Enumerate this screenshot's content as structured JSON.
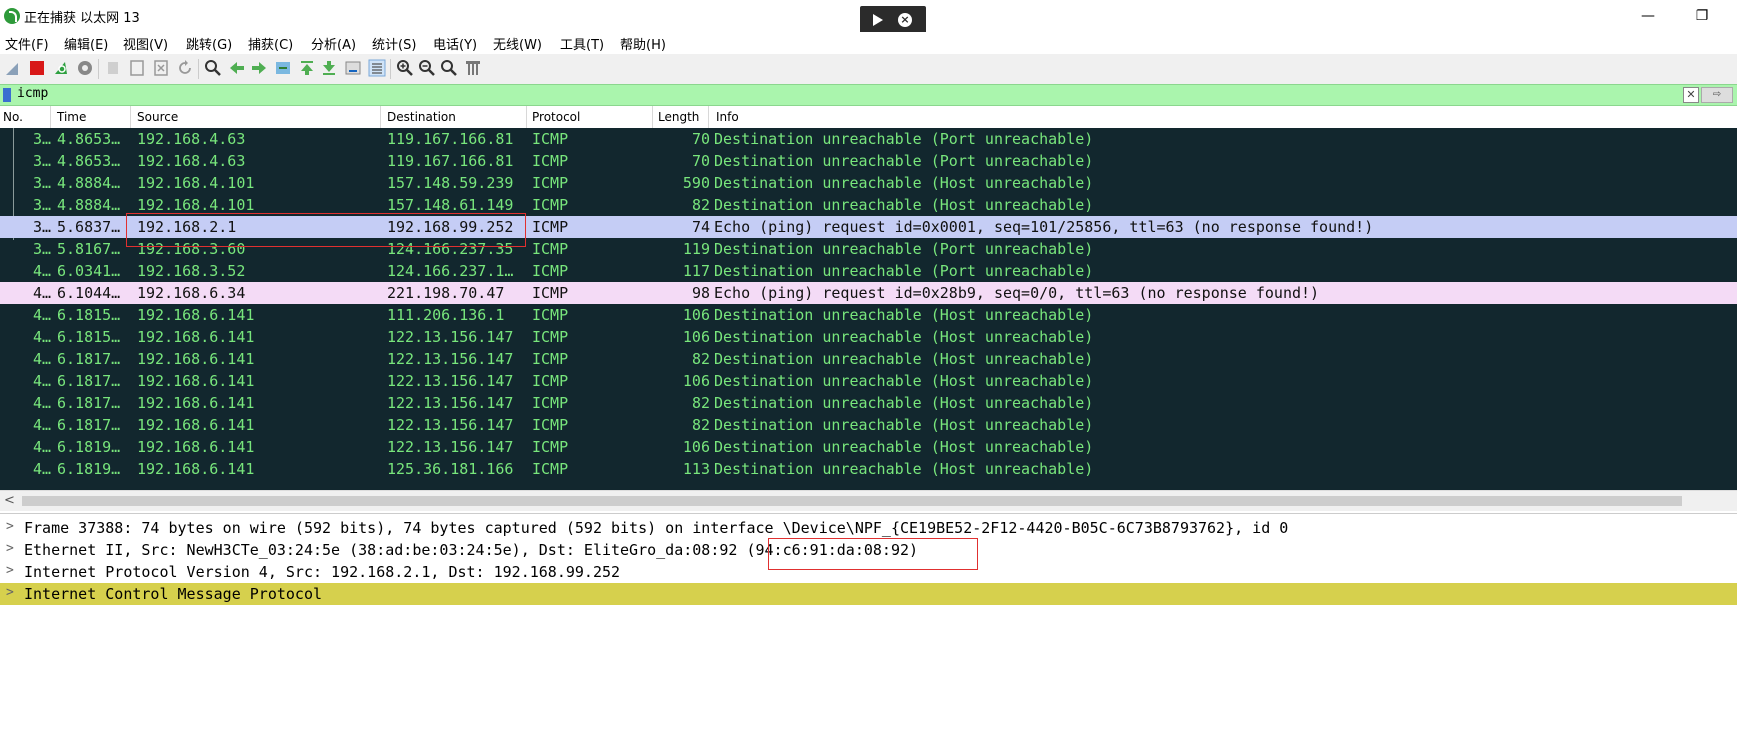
{
  "window": {
    "title": "正在捕获 以太网 13",
    "min": "—",
    "max": "❐"
  },
  "menu": [
    "文件(F)",
    "编辑(E)",
    "视图(V)",
    "跳转(G)",
    "捕获(C)",
    "分析(A)",
    "统计(S)",
    "电话(Y)",
    "无线(W)",
    "工具(T)",
    "帮助(H)"
  ],
  "filter": {
    "value": "icmp",
    "clear": "✕",
    "apply": "⇨"
  },
  "columns": {
    "no": "No.",
    "time": "Time",
    "source": "Source",
    "destination": "Destination",
    "protocol": "Protocol",
    "length": "Length",
    "info": "Info"
  },
  "packets": [
    {
      "no": "3…",
      "time": "4.8653…",
      "src": "192.168.4.63",
      "dst": "119.167.166.81",
      "proto": "ICMP",
      "len": "70",
      "info": "Destination unreachable (Port unreachable)"
    },
    {
      "no": "3…",
      "time": "4.8653…",
      "src": "192.168.4.63",
      "dst": "119.167.166.81",
      "proto": "ICMP",
      "len": "70",
      "info": "Destination unreachable (Port unreachable)"
    },
    {
      "no": "3…",
      "time": "4.8884…",
      "src": "192.168.4.101",
      "dst": "157.148.59.239",
      "proto": "ICMP",
      "len": "590",
      "info": "Destination unreachable (Host unreachable)"
    },
    {
      "no": "3…",
      "time": "4.8884…",
      "src": "192.168.4.101",
      "dst": "157.148.61.149",
      "proto": "ICMP",
      "len": "82",
      "info": "Destination unreachable (Host unreachable)"
    },
    {
      "no": "3…",
      "time": "5.6837…",
      "src": "192.168.2.1",
      "dst": "192.168.99.252",
      "proto": "ICMP",
      "len": "74",
      "info": "Echo (ping) request  id=0x0001, seq=101/25856, ttl=63 (no response found!)"
    },
    {
      "no": "3…",
      "time": "5.8167…",
      "src": "192.168.3.60",
      "dst": "124.166.237.35",
      "proto": "ICMP",
      "len": "119",
      "info": "Destination unreachable (Port unreachable)"
    },
    {
      "no": "4…",
      "time": "6.0341…",
      "src": "192.168.3.52",
      "dst": "124.166.237.1…",
      "proto": "ICMP",
      "len": "117",
      "info": "Destination unreachable (Port unreachable)"
    },
    {
      "no": "4…",
      "time": "6.1044…",
      "src": "192.168.6.34",
      "dst": "221.198.70.47",
      "proto": "ICMP",
      "len": "98",
      "info": "Echo (ping) request  id=0x28b9, seq=0/0, ttl=63 (no response found!)"
    },
    {
      "no": "4…",
      "time": "6.1815…",
      "src": "192.168.6.141",
      "dst": "111.206.136.1",
      "proto": "ICMP",
      "len": "106",
      "info": "Destination unreachable (Host unreachable)"
    },
    {
      "no": "4…",
      "time": "6.1815…",
      "src": "192.168.6.141",
      "dst": "122.13.156.147",
      "proto": "ICMP",
      "len": "106",
      "info": "Destination unreachable (Host unreachable)"
    },
    {
      "no": "4…",
      "time": "6.1817…",
      "src": "192.168.6.141",
      "dst": "122.13.156.147",
      "proto": "ICMP",
      "len": "82",
      "info": "Destination unreachable (Host unreachable)"
    },
    {
      "no": "4…",
      "time": "6.1817…",
      "src": "192.168.6.141",
      "dst": "122.13.156.147",
      "proto": "ICMP",
      "len": "106",
      "info": "Destination unreachable (Host unreachable)"
    },
    {
      "no": "4…",
      "time": "6.1817…",
      "src": "192.168.6.141",
      "dst": "122.13.156.147",
      "proto": "ICMP",
      "len": "82",
      "info": "Destination unreachable (Host unreachable)"
    },
    {
      "no": "4…",
      "time": "6.1817…",
      "src": "192.168.6.141",
      "dst": "122.13.156.147",
      "proto": "ICMP",
      "len": "82",
      "info": "Destination unreachable (Host unreachable)"
    },
    {
      "no": "4…",
      "time": "6.1819…",
      "src": "192.168.6.141",
      "dst": "122.13.156.147",
      "proto": "ICMP",
      "len": "106",
      "info": "Destination unreachable (Host unreachable)"
    },
    {
      "no": "4…",
      "time": "6.1819…",
      "src": "192.168.6.141",
      "dst": "125.36.181.166",
      "proto": "ICMP",
      "len": "113",
      "info": "Destination unreachable (Host unreachable)"
    }
  ],
  "scroll_left": "<",
  "details": [
    {
      "arrow": ">",
      "text": "Frame 37388: 74 bytes on wire (592 bits), 74 bytes captured (592 bits) on interface \\Device\\NPF_{CE19BE52-2F12-4420-B05C-6C73B8793762}, id 0"
    },
    {
      "arrow": ">",
      "text": "Ethernet II, Src: NewH3CTe_03:24:5e (38:ad:be:03:24:5e), Dst: EliteGro_da:08:92 (94:c6:91:da:08:92)"
    },
    {
      "arrow": ">",
      "text": "Internet Protocol Version 4, Src: 192.168.2.1, Dst: 192.168.99.252"
    },
    {
      "arrow": ">",
      "text": "Internet Control Message Protocol"
    }
  ],
  "colors": {
    "list_bg": "#12272e",
    "list_fg": "#78e67c",
    "selected": "#c5cdf5",
    "pink": "#f4dbf6",
    "filter_bg": "#aaf5ad",
    "highlight": "#d6d04d",
    "annotation": "#e03030"
  }
}
